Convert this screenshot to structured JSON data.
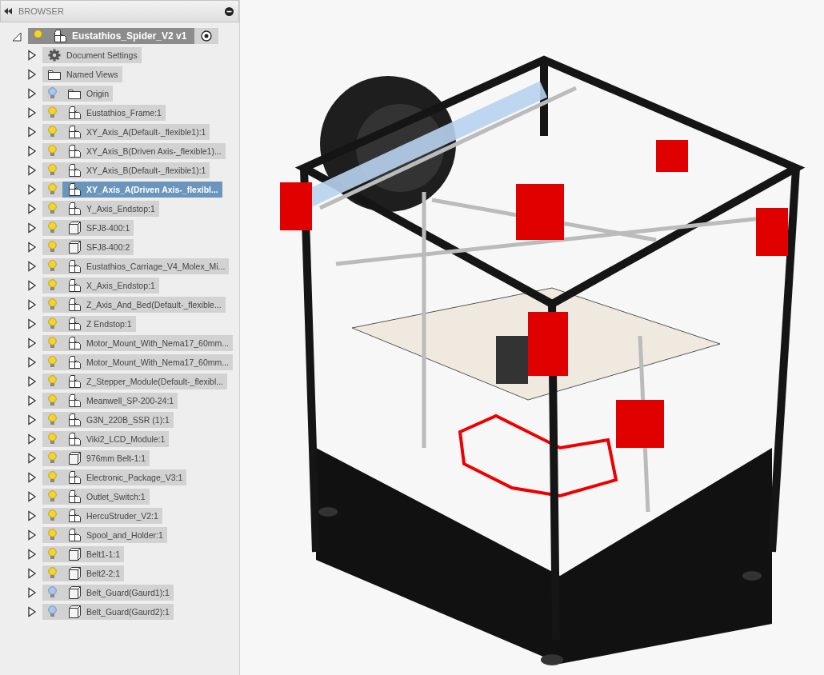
{
  "browser": {
    "title": "BROWSER",
    "root": {
      "label": "Eustathios_Spider_V2 v1",
      "visible": true,
      "expanded": true,
      "selected": false,
      "active": true,
      "children": [
        {
          "kind": "settings",
          "label": "Document Settings",
          "selected": false
        },
        {
          "kind": "folder",
          "label": "Named Views",
          "selected": false
        },
        {
          "kind": "folder",
          "label": "Origin",
          "visible": false,
          "selected": false
        },
        {
          "kind": "component",
          "label": "Eustathios_Frame:1",
          "visible": true,
          "selected": false
        },
        {
          "kind": "component",
          "label": "XY_Axis_A(Default-_flexible1):1",
          "visible": true,
          "selected": false
        },
        {
          "kind": "component",
          "label": "XY_Axis_B(Driven Axis-_flexible1)...",
          "visible": true,
          "selected": false
        },
        {
          "kind": "component",
          "label": "XY_Axis_B(Default-_flexible1):1",
          "visible": true,
          "selected": false
        },
        {
          "kind": "component",
          "label": "XY_Axis_A(Driven Axis-_flexibl...",
          "visible": true,
          "selected": true
        },
        {
          "kind": "component",
          "label": "Y_Axis_Endstop:1",
          "visible": true,
          "selected": false
        },
        {
          "kind": "body",
          "label": "SFJ8-400:1",
          "visible": true,
          "selected": false
        },
        {
          "kind": "body",
          "label": "SFJ8-400:2",
          "visible": true,
          "selected": false
        },
        {
          "kind": "component",
          "label": "Eustathios_Carriage_V4_Molex_Mi...",
          "visible": true,
          "selected": false
        },
        {
          "kind": "component",
          "label": "X_Axis_Endstop:1",
          "visible": true,
          "selected": false
        },
        {
          "kind": "component",
          "label": "Z_Axis_And_Bed(Default-_flexible...",
          "visible": true,
          "selected": false
        },
        {
          "kind": "component",
          "label": "Z Endstop:1",
          "visible": true,
          "selected": false
        },
        {
          "kind": "component",
          "label": "Motor_Mount_With_Nema17_60mm...",
          "visible": true,
          "selected": false
        },
        {
          "kind": "component",
          "label": "Motor_Mount_With_Nema17_60mm...",
          "visible": true,
          "selected": false
        },
        {
          "kind": "component",
          "label": "Z_Stepper_Module(Default-_flexibl...",
          "visible": true,
          "selected": false
        },
        {
          "kind": "component",
          "label": "Meanwell_SP-200-24:1",
          "visible": true,
          "selected": false
        },
        {
          "kind": "component",
          "label": "G3N_220B_SSR (1):1",
          "visible": true,
          "selected": false
        },
        {
          "kind": "component",
          "label": "Viki2_LCD_Module:1",
          "visible": true,
          "selected": false
        },
        {
          "kind": "body",
          "label": "976mm Belt-1:1",
          "visible": true,
          "selected": false
        },
        {
          "kind": "component",
          "label": "Electronic_Package_V3:1",
          "visible": true,
          "selected": false
        },
        {
          "kind": "component",
          "label": "Outlet_Switch:1",
          "visible": true,
          "selected": false
        },
        {
          "kind": "component",
          "label": "HercuStruder_V2:1",
          "visible": true,
          "selected": false
        },
        {
          "kind": "component",
          "label": "Spool_and_Holder:1",
          "visible": true,
          "selected": false
        },
        {
          "kind": "body",
          "label": "Belt1-1:1",
          "visible": true,
          "selected": false
        },
        {
          "kind": "body",
          "label": "Belt2-2:1",
          "visible": true,
          "selected": false
        },
        {
          "kind": "body",
          "label": "Belt_Guard(Gaurd1):1",
          "visible": false,
          "selected": false
        },
        {
          "kind": "body",
          "label": "Belt_Guard(Gaurd2):1",
          "visible": false,
          "selected": false
        }
      ]
    }
  }
}
